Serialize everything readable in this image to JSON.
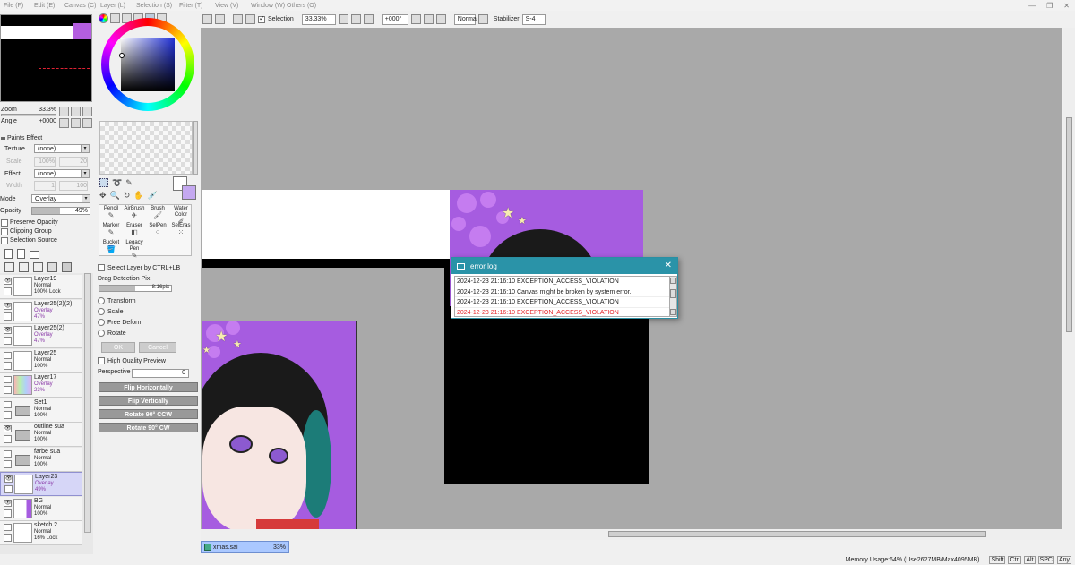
{
  "menu": [
    "File (F)",
    "Edit (E)",
    "Canvas (C)",
    "Layer (L)",
    "Selection (S)",
    "Filter (T)",
    "View (V)",
    "Window (W)",
    "Others (O)"
  ],
  "toolbar": {
    "selection_label": "Selection",
    "zoom": "33.33%",
    "rotation": "+000°",
    "blend": "Normal",
    "stabilizer_label": "Stabilizer",
    "stabilizer_value": "S-4"
  },
  "navigator": {
    "zoom_label": "Zoom",
    "zoom_value": "33.3%",
    "angle_label": "Angle",
    "angle_value": "+0000"
  },
  "paints_effect": {
    "title": "Paints Effect",
    "texture_label": "Texture",
    "texture_value": "(none)",
    "scale_label": "Scale",
    "scale_value": "100%",
    "scale_num": "20",
    "effect_label": "Effect",
    "effect_value": "(none)",
    "width_label": "Width",
    "width_value": "1",
    "width_num": "100"
  },
  "layer_props": {
    "mode_label": "Mode",
    "mode_value": "Overlay",
    "opacity_label": "Opacity",
    "opacity_value": "49%",
    "opacity_fraction": 0.49,
    "preserve_opacity": "Preserve Opacity",
    "clipping_group": "Clipping Group",
    "selection_source": "Selection Source"
  },
  "layers": [
    {
      "name": "Layer19",
      "mode": "Normal",
      "opacity": "100% Lock",
      "overlay": false,
      "visible": true
    },
    {
      "name": "Layer25(2)(2)",
      "mode": "Overlay",
      "opacity": "47%",
      "overlay": true,
      "visible": true
    },
    {
      "name": "Layer25(2)",
      "mode": "Overlay",
      "opacity": "47%",
      "overlay": true,
      "visible": true
    },
    {
      "name": "Layer25",
      "mode": "Normal",
      "opacity": "100%",
      "overlay": false,
      "visible": false
    },
    {
      "name": "Layer17",
      "mode": "Overlay",
      "opacity": "23%",
      "overlay": true,
      "visible": false
    },
    {
      "name": "Set1",
      "mode": "Normal",
      "opacity": "100%",
      "overlay": false,
      "visible": false
    },
    {
      "name": "outline sua",
      "mode": "Normal",
      "opacity": "100%",
      "overlay": false,
      "visible": true
    },
    {
      "name": "farbe sua",
      "mode": "Normal",
      "opacity": "100%",
      "overlay": false,
      "visible": false
    },
    {
      "name": "Layer23",
      "mode": "Overlay",
      "opacity": "49%",
      "overlay": true,
      "visible": true
    },
    {
      "name": "BG",
      "mode": "Normal",
      "opacity": "100%",
      "overlay": false,
      "visible": true
    },
    {
      "name": "sketch 2",
      "mode": "Normal",
      "opacity": "16% Lock",
      "overlay": false,
      "visible": false
    }
  ],
  "tools": {
    "brushes": [
      "Pencil",
      "AirBrush",
      "Brush",
      "Water Color",
      "Marker",
      "Eraser",
      "SelPen",
      "SelEras",
      "Bucket",
      "Legacy Pen"
    ],
    "select_layer_ctrl": "Select Layer by CTRL+LB",
    "drag_detection": "Drag Detection Pix.",
    "drag_value": "8:16pix",
    "transform": "Transform",
    "scale": "Scale",
    "free_deform": "Free Deform",
    "rotate": "Rotate",
    "ok": "OK",
    "cancel": "Cancel",
    "hq_preview": "High Quality Preview",
    "perspective": "Perspective",
    "perspective_value": "0",
    "flip_h": "Flip Horizontally",
    "flip_v": "Flip Vertically",
    "rot_ccw": "Rotate 90° CCW",
    "rot_cw": "Rotate 90° CW"
  },
  "dialog": {
    "title": "error log",
    "lines": [
      {
        "text": "2024-12-23 21:16:10 EXCEPTION_ACCESS_VIOLATION",
        "red": false
      },
      {
        "text": "2024-12-23 21:16:10 Canvas might be broken by system error.",
        "red": false
      },
      {
        "text": "2024-12-23 21:16:10 EXCEPTION_ACCESS_VIOLATION",
        "red": false
      },
      {
        "text": "2024-12-23 21:16:10 EXCEPTION_ACCESS_VIOLATION",
        "red": true
      }
    ]
  },
  "tab": {
    "name": "xmas.sai",
    "zoom": "33%"
  },
  "status": {
    "memory": "Memory Usage:64% (Use2627MB/Max4095MB)",
    "keys": [
      "Shift",
      "Ctrl",
      "Alt",
      "SPC",
      "Any"
    ]
  },
  "colors": {
    "accent": "#2a93a8",
    "canvas_bg": "#a9a9a9",
    "purple": "#a65ce0",
    "error_red": "#e4262b",
    "primary_swatch": "#c4a8f0"
  }
}
